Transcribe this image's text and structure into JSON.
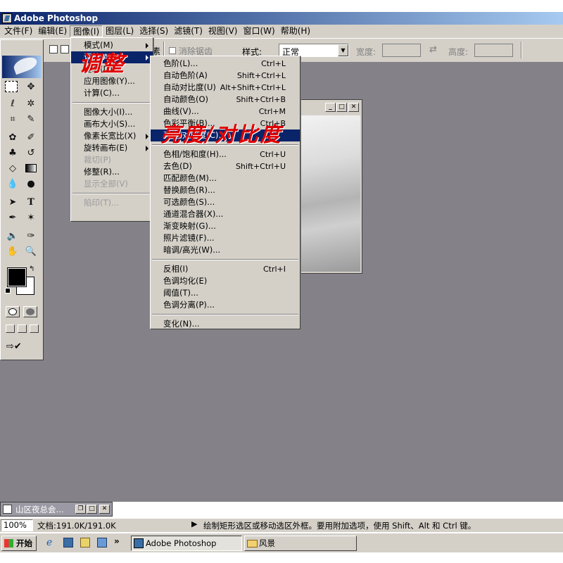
{
  "window": {
    "title": "Adobe Photoshop"
  },
  "menubar": [
    {
      "label": "文件(F)"
    },
    {
      "label": "编辑(E)"
    },
    {
      "label": "图像(I)"
    },
    {
      "label": "图层(L)"
    },
    {
      "label": "选择(S)"
    },
    {
      "label": "滤镜(T)"
    },
    {
      "label": "视图(V)"
    },
    {
      "label": "窗口(W)"
    },
    {
      "label": "帮助(H)"
    }
  ],
  "options": {
    "partial_text": "素",
    "antialias_label": "消除锯齿",
    "style_label": "样式:",
    "style_value": "正常",
    "width_label": "宽度:",
    "height_label": "高度:"
  },
  "image_menu": [
    {
      "label": "模式(M)"
    },
    {
      "label": "调整(A)"
    },
    {
      "label": "复制(D)..."
    },
    {
      "label": "应用图像(Y)..."
    },
    {
      "label": "计算(C)..."
    },
    {
      "label": "图像大小(I)..."
    },
    {
      "label": "画布大小(S)..."
    },
    {
      "label": "像素长宽比(X)"
    },
    {
      "label": "旋转画布(E)"
    },
    {
      "label": "裁切(P)"
    },
    {
      "label": "修整(R)..."
    },
    {
      "label": "显示全部(V)"
    },
    {
      "label": "陷印(T)..."
    }
  ],
  "adjust_menu": [
    {
      "label": "色阶(L)...",
      "sc": "Ctrl+L"
    },
    {
      "label": "自动色阶(A)",
      "sc": "Shift+Ctrl+L"
    },
    {
      "label": "自动对比度(U)",
      "sc": "Alt+Shift+Ctrl+L"
    },
    {
      "label": "自动颜色(O)",
      "sc": "Shift+Ctrl+B"
    },
    {
      "label": "曲线(V)...",
      "sc": "Ctrl+M"
    },
    {
      "label": "色彩平衡(B)...",
      "sc": "Ctrl+B"
    },
    {
      "label": "亮度/对比度(C)...",
      "sc": ""
    },
    {
      "label": "色相/饱和度(H)...",
      "sc": "Ctrl+U"
    },
    {
      "label": "去色(D)",
      "sc": "Shift+Ctrl+U"
    },
    {
      "label": "匹配颜色(M)...",
      "sc": ""
    },
    {
      "label": "替换颜色(R)...",
      "sc": ""
    },
    {
      "label": "可选颜色(S)...",
      "sc": ""
    },
    {
      "label": "通道混合器(X)...",
      "sc": ""
    },
    {
      "label": "渐变映射(G)...",
      "sc": ""
    },
    {
      "label": "照片滤镜(F)...",
      "sc": ""
    },
    {
      "label": "暗调/高光(W)...",
      "sc": ""
    },
    {
      "label": "反相(I)",
      "sc": "Ctrl+I"
    },
    {
      "label": "色调均化(E)",
      "sc": ""
    },
    {
      "label": "阈值(T)...",
      "sc": ""
    },
    {
      "label": "色调分离(P)...",
      "sc": ""
    },
    {
      "label": "变化(N)...",
      "sc": ""
    }
  ],
  "annotations": {
    "adjust": "调整",
    "brightness": "亮度/对比度"
  },
  "minimized_doc": {
    "title": "山区夜总会..."
  },
  "status": {
    "zoom": "100%",
    "doc": "文档:191.0K/191.0K",
    "hint": "绘制矩形选区或移动选区外框。要用附加选项，使用 Shift、Alt 和 Ctrl 键。"
  },
  "taskbar": {
    "start": "开始",
    "more": "»",
    "task1": "Adobe Photoshop",
    "task2": "风景"
  },
  "colors": {
    "highlight": "#0a246a",
    "annotation": "#e00000",
    "workspace": "#858189"
  }
}
